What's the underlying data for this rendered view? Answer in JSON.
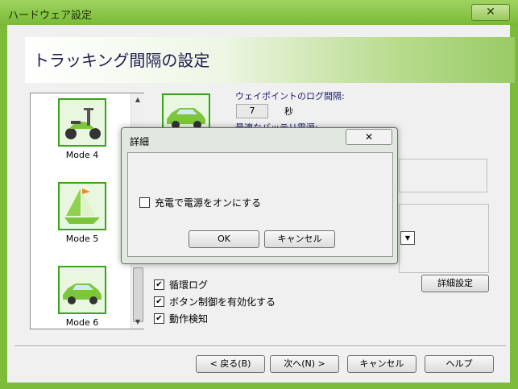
{
  "window": {
    "title": "ハードウェア設定",
    "close_glyph": "✕"
  },
  "banner": {
    "title": "トラッキング間隔の設定"
  },
  "modes": [
    {
      "label": "Mode 4",
      "icon": "scooter-icon"
    },
    {
      "label": "Mode 5",
      "icon": "sailboat-icon"
    },
    {
      "label": "Mode 6",
      "icon": "car-icon"
    }
  ],
  "scrollbar": {
    "up": "▲",
    "down": "▼"
  },
  "settings": {
    "waypoint_label": "ウェイポイントのログ間隔:",
    "interval_value": "7",
    "interval_unit": "秒",
    "battery_label": "最適なバッテリ電源:"
  },
  "checkboxes": [
    {
      "label": "循環ログ",
      "checked": true
    },
    {
      "label": "ボタン制御を有効化する",
      "checked": true
    },
    {
      "label": "動作検知",
      "checked": true
    }
  ],
  "check_glyph": "✔",
  "advanced_button": "詳細設定",
  "nav": {
    "back": "< 戻る(B)",
    "next": "次へ(N) >",
    "cancel": "キャンセル",
    "help": "ヘルプ"
  },
  "dialog": {
    "title": "詳細",
    "close_glyph": "✕",
    "checkbox_label": "充電で電源をオンにする",
    "ok": "OK",
    "cancel": "キャンセル"
  },
  "combo_arrow": "▼",
  "colors": {
    "accent_green": "#7dbb3a",
    "thumb_border": "#3aa317"
  }
}
